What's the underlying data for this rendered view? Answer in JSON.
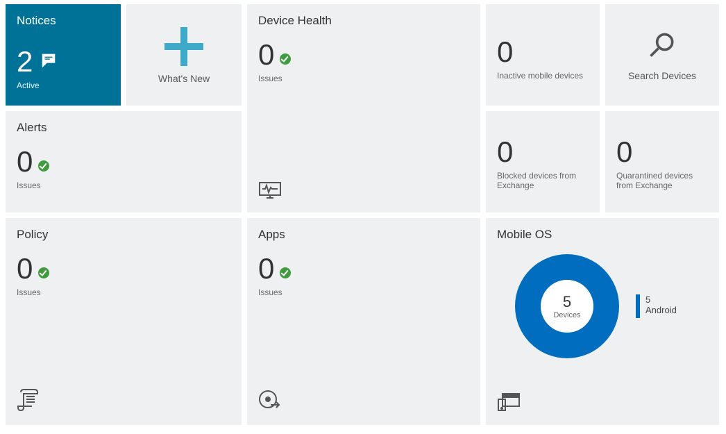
{
  "colors": {
    "accent": "#007297",
    "chart": "#006dbe",
    "ok": "#3e9b3e"
  },
  "tiles": {
    "notices": {
      "title": "Notices",
      "value": "2",
      "label": "Active"
    },
    "whatsnew": {
      "label": "What's New"
    },
    "device_health": {
      "title": "Device Health",
      "value": "0",
      "label": "Issues"
    },
    "inactive": {
      "value": "0",
      "label": "Inactive mobile devices"
    },
    "search": {
      "label": "Search Devices"
    },
    "alerts": {
      "title": "Alerts",
      "value": "0",
      "label": "Issues"
    },
    "blocked": {
      "value": "0",
      "label": "Blocked devices from Exchange"
    },
    "quarantined": {
      "value": "0",
      "label": "Quarantined devices from Exchange"
    },
    "policy": {
      "title": "Policy",
      "value": "0",
      "label": "Issues"
    },
    "apps": {
      "title": "Apps",
      "value": "0",
      "label": "Issues"
    },
    "mobile_os": {
      "title": "Mobile OS",
      "total_value": "5",
      "total_label": "Devices",
      "legend_value": "5",
      "legend_label": "Android"
    }
  },
  "chart_data": {
    "type": "pie",
    "title": "Mobile OS",
    "categories": [
      "Android"
    ],
    "values": [
      5
    ],
    "total": 5,
    "total_label": "Devices"
  }
}
